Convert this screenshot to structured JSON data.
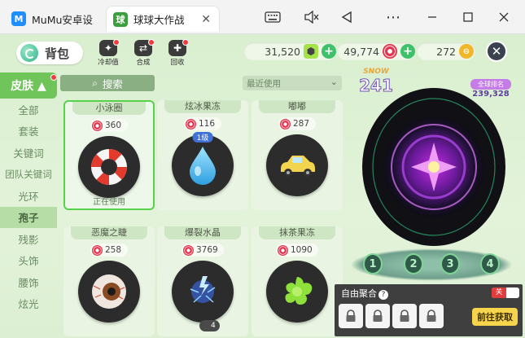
{
  "window": {
    "tabs": [
      {
        "label": "MuMu安卓设",
        "icon": "mumu-app-icon"
      },
      {
        "label": "球球大作战",
        "icon": "game-app-icon"
      }
    ],
    "controls": [
      "keyboard-icon",
      "mute-icon",
      "back-icon",
      "more-icon",
      "minimize-icon",
      "maximize-icon",
      "close-icon"
    ]
  },
  "topbar": {
    "bag_label": "背包",
    "icons": [
      {
        "label": "冷却值"
      },
      {
        "label": "合成"
      },
      {
        "label": "回收"
      }
    ],
    "currencies": [
      {
        "value": "31,520",
        "icon": "green-gem-icon"
      },
      {
        "value": "49,774",
        "icon": "candy-icon"
      },
      {
        "value": "272",
        "icon": "gold-coin-icon"
      }
    ]
  },
  "sidebar": {
    "items": [
      {
        "label": "皮肤 ▲"
      },
      {
        "label": "全部"
      },
      {
        "label": "套装"
      },
      {
        "label": "关键词"
      },
      {
        "label": "团队关键词"
      },
      {
        "label": "光环"
      },
      {
        "label": "孢子"
      },
      {
        "label": "残影"
      },
      {
        "label": "头饰"
      },
      {
        "label": "腰饰"
      },
      {
        "label": "炫光"
      }
    ]
  },
  "search": {
    "label": "搜索"
  },
  "filter": {
    "label": "最近使用"
  },
  "cards": [
    {
      "name": "小泳圈",
      "price": "360",
      "status": "正在使用",
      "art": "swim-ring"
    },
    {
      "name": "炫冰果冻",
      "price": "116",
      "level": "1级",
      "art": "water-drop"
    },
    {
      "name": "嘟嘟",
      "price": "287",
      "art": "yellow-car"
    },
    {
      "name": "恶魔之睫",
      "price": "258",
      "art": "eyeball"
    },
    {
      "name": "爆裂水晶",
      "price": "3769",
      "badge": "4",
      "art": "lightning-crystal"
    },
    {
      "name": "抹茶果冻",
      "price": "1090",
      "art": "green-jelly"
    }
  ],
  "preview": {
    "snow_label": "SNOW",
    "snow_value": "241",
    "full_label": "全球排名",
    "full_value": "239,328",
    "slots": [
      "1",
      "2",
      "3",
      "4"
    ]
  },
  "free_combo": {
    "title": "自由聚合",
    "toggle": "关",
    "get_button": "前往获取"
  }
}
